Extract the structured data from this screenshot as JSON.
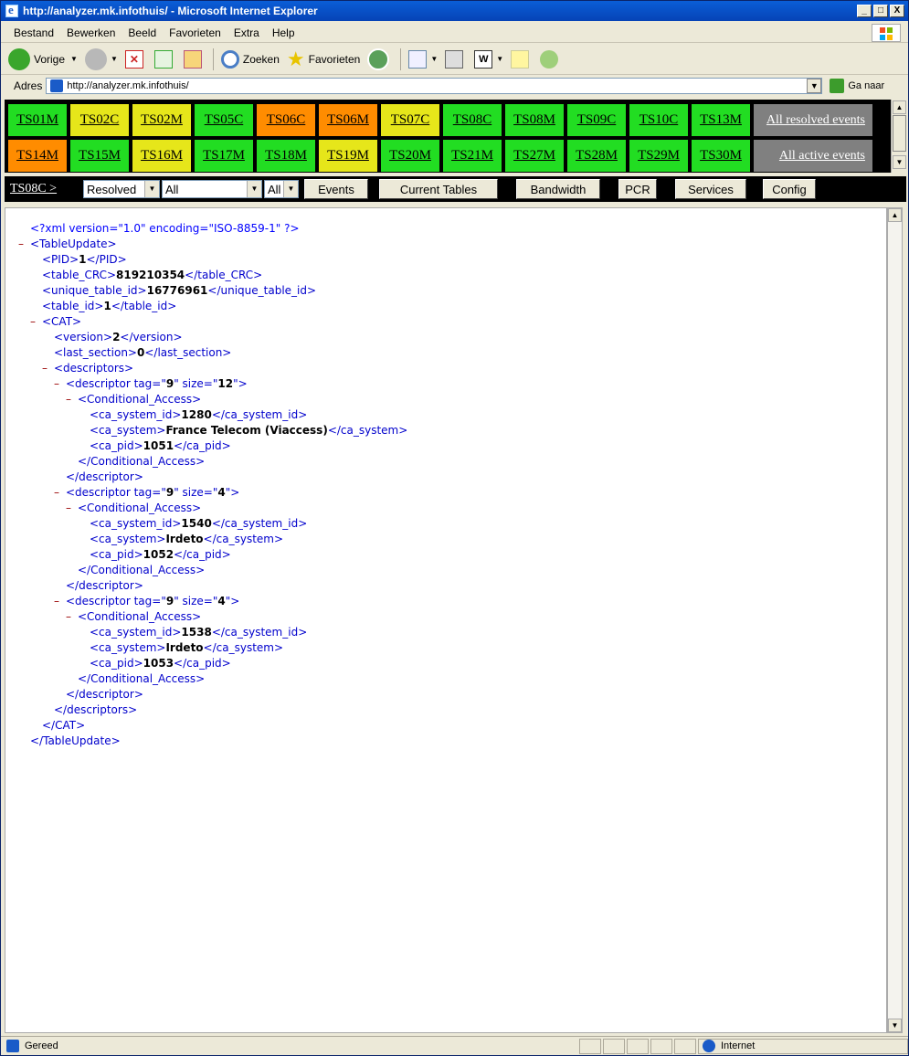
{
  "window": {
    "title": "http://analyzer.mk.infothuis/ - Microsoft Internet Explorer",
    "min": "_",
    "max": "□",
    "close": "X"
  },
  "menu": [
    "Bestand",
    "Bewerken",
    "Beeld",
    "Favorieten",
    "Extra",
    "Help"
  ],
  "toolbar": {
    "back": "Vorige",
    "search": "Zoeken",
    "favorites": "Favorieten"
  },
  "address": {
    "label": "Adres",
    "url": "http://analyzer.mk.infothuis/",
    "go": "Ga naar"
  },
  "ts_rows": [
    [
      {
        "label": "TS01M",
        "status": "green"
      },
      {
        "label": "TS02C",
        "status": "yellow"
      },
      {
        "label": "TS02M",
        "status": "yellow"
      },
      {
        "label": "TS05C",
        "status": "green"
      },
      {
        "label": "TS06C",
        "status": "orange"
      },
      {
        "label": "TS06M",
        "status": "orange"
      },
      {
        "label": "TS07C",
        "status": "yellow"
      },
      {
        "label": "TS08C",
        "status": "green"
      },
      {
        "label": "TS08M",
        "status": "green"
      },
      {
        "label": "TS09C",
        "status": "green"
      },
      {
        "label": "TS10C",
        "status": "green"
      },
      {
        "label": "TS13M",
        "status": "green"
      },
      {
        "label": "All resolved events",
        "status": "gray"
      }
    ],
    [
      {
        "label": "TS14M",
        "status": "orange"
      },
      {
        "label": "TS15M",
        "status": "green"
      },
      {
        "label": "TS16M",
        "status": "yellow"
      },
      {
        "label": "TS17M",
        "status": "green"
      },
      {
        "label": "TS18M",
        "status": "green"
      },
      {
        "label": "TS19M",
        "status": "yellow"
      },
      {
        "label": "TS20M",
        "status": "green"
      },
      {
        "label": "TS21M",
        "status": "green"
      },
      {
        "label": "TS27M",
        "status": "green"
      },
      {
        "label": "TS28M",
        "status": "green"
      },
      {
        "label": "TS29M",
        "status": "green"
      },
      {
        "label": "TS30M",
        "status": "green"
      },
      {
        "label": "All active events",
        "status": "gray"
      }
    ]
  ],
  "nav": {
    "crumb": "TS08C >",
    "select_state": "Resolved",
    "select_filter": "All",
    "select_filter2": "All",
    "buttons": [
      "Events",
      "Current Tables",
      "Bandwidth",
      "PCR",
      "Services",
      "Config"
    ]
  },
  "xml_lines": [
    {
      "indent": 0,
      "minus": "",
      "parts": [
        {
          "t": "pi",
          "v": "<?xml version=\"1.0\" encoding=\"ISO-8859-1\" ?>"
        }
      ]
    },
    {
      "indent": 0,
      "minus": "–",
      "parts": [
        {
          "t": "tg",
          "v": "<TableUpdate>"
        }
      ]
    },
    {
      "indent": 1,
      "minus": "",
      "parts": [
        {
          "t": "tg",
          "v": "<PID>"
        },
        {
          "t": "val",
          "v": "1"
        },
        {
          "t": "tg",
          "v": "</PID>"
        }
      ]
    },
    {
      "indent": 1,
      "minus": "",
      "parts": [
        {
          "t": "tg",
          "v": "<table_CRC>"
        },
        {
          "t": "val",
          "v": "819210354"
        },
        {
          "t": "tg",
          "v": "</table_CRC>"
        }
      ]
    },
    {
      "indent": 1,
      "minus": "",
      "parts": [
        {
          "t": "tg",
          "v": "<unique_table_id>"
        },
        {
          "t": "val",
          "v": "16776961"
        },
        {
          "t": "tg",
          "v": "</unique_table_id>"
        }
      ]
    },
    {
      "indent": 1,
      "minus": "",
      "parts": [
        {
          "t": "tg",
          "v": "<table_id>"
        },
        {
          "t": "val",
          "v": "1"
        },
        {
          "t": "tg",
          "v": "</table_id>"
        }
      ]
    },
    {
      "indent": 1,
      "minus": "–",
      "parts": [
        {
          "t": "tg",
          "v": "<CAT>"
        }
      ]
    },
    {
      "indent": 2,
      "minus": "",
      "parts": [
        {
          "t": "tg",
          "v": "<version>"
        },
        {
          "t": "val",
          "v": "2"
        },
        {
          "t": "tg",
          "v": "</version>"
        }
      ]
    },
    {
      "indent": 2,
      "minus": "",
      "parts": [
        {
          "t": "tg",
          "v": "<last_section>"
        },
        {
          "t": "val",
          "v": "0"
        },
        {
          "t": "tg",
          "v": "</last_section>"
        }
      ]
    },
    {
      "indent": 2,
      "minus": "–",
      "parts": [
        {
          "t": "tg",
          "v": "<descriptors>"
        }
      ]
    },
    {
      "indent": 3,
      "minus": "–",
      "parts": [
        {
          "t": "tg",
          "v": "<descriptor tag=\""
        },
        {
          "t": "val",
          "v": "9"
        },
        {
          "t": "tg",
          "v": "\" size=\""
        },
        {
          "t": "val",
          "v": "12"
        },
        {
          "t": "tg",
          "v": "\">"
        }
      ]
    },
    {
      "indent": 4,
      "minus": "–",
      "parts": [
        {
          "t": "tg",
          "v": "<Conditional_Access>"
        }
      ]
    },
    {
      "indent": 5,
      "minus": "",
      "parts": [
        {
          "t": "tg",
          "v": "<ca_system_id>"
        },
        {
          "t": "val",
          "v": "1280"
        },
        {
          "t": "tg",
          "v": "</ca_system_id>"
        }
      ]
    },
    {
      "indent": 5,
      "minus": "",
      "parts": [
        {
          "t": "tg",
          "v": "<ca_system>"
        },
        {
          "t": "val",
          "v": "France Telecom (Viaccess)"
        },
        {
          "t": "tg",
          "v": "</ca_system>"
        }
      ]
    },
    {
      "indent": 5,
      "minus": "",
      "parts": [
        {
          "t": "tg",
          "v": "<ca_pid>"
        },
        {
          "t": "val",
          "v": "1051"
        },
        {
          "t": "tg",
          "v": "</ca_pid>"
        }
      ]
    },
    {
      "indent": 4,
      "minus": "",
      "parts": [
        {
          "t": "tg",
          "v": "</Conditional_Access>"
        }
      ]
    },
    {
      "indent": 3,
      "minus": "",
      "parts": [
        {
          "t": "tg",
          "v": "</descriptor>"
        }
      ]
    },
    {
      "indent": 3,
      "minus": "–",
      "parts": [
        {
          "t": "tg",
          "v": "<descriptor tag=\""
        },
        {
          "t": "val",
          "v": "9"
        },
        {
          "t": "tg",
          "v": "\" size=\""
        },
        {
          "t": "val",
          "v": "4"
        },
        {
          "t": "tg",
          "v": "\">"
        }
      ]
    },
    {
      "indent": 4,
      "minus": "–",
      "parts": [
        {
          "t": "tg",
          "v": "<Conditional_Access>"
        }
      ]
    },
    {
      "indent": 5,
      "minus": "",
      "parts": [
        {
          "t": "tg",
          "v": "<ca_system_id>"
        },
        {
          "t": "val",
          "v": "1540"
        },
        {
          "t": "tg",
          "v": "</ca_system_id>"
        }
      ]
    },
    {
      "indent": 5,
      "minus": "",
      "parts": [
        {
          "t": "tg",
          "v": "<ca_system>"
        },
        {
          "t": "val",
          "v": "Irdeto"
        },
        {
          "t": "tg",
          "v": "</ca_system>"
        }
      ]
    },
    {
      "indent": 5,
      "minus": "",
      "parts": [
        {
          "t": "tg",
          "v": "<ca_pid>"
        },
        {
          "t": "val",
          "v": "1052"
        },
        {
          "t": "tg",
          "v": "</ca_pid>"
        }
      ]
    },
    {
      "indent": 4,
      "minus": "",
      "parts": [
        {
          "t": "tg",
          "v": "</Conditional_Access>"
        }
      ]
    },
    {
      "indent": 3,
      "minus": "",
      "parts": [
        {
          "t": "tg",
          "v": "</descriptor>"
        }
      ]
    },
    {
      "indent": 3,
      "minus": "–",
      "parts": [
        {
          "t": "tg",
          "v": "<descriptor tag=\""
        },
        {
          "t": "val",
          "v": "9"
        },
        {
          "t": "tg",
          "v": "\" size=\""
        },
        {
          "t": "val",
          "v": "4"
        },
        {
          "t": "tg",
          "v": "\">"
        }
      ]
    },
    {
      "indent": 4,
      "minus": "–",
      "parts": [
        {
          "t": "tg",
          "v": "<Conditional_Access>"
        }
      ]
    },
    {
      "indent": 5,
      "minus": "",
      "parts": [
        {
          "t": "tg",
          "v": "<ca_system_id>"
        },
        {
          "t": "val",
          "v": "1538"
        },
        {
          "t": "tg",
          "v": "</ca_system_id>"
        }
      ]
    },
    {
      "indent": 5,
      "minus": "",
      "parts": [
        {
          "t": "tg",
          "v": "<ca_system>"
        },
        {
          "t": "val",
          "v": "Irdeto"
        },
        {
          "t": "tg",
          "v": "</ca_system>"
        }
      ]
    },
    {
      "indent": 5,
      "minus": "",
      "parts": [
        {
          "t": "tg",
          "v": "<ca_pid>"
        },
        {
          "t": "val",
          "v": "1053"
        },
        {
          "t": "tg",
          "v": "</ca_pid>"
        }
      ]
    },
    {
      "indent": 4,
      "minus": "",
      "parts": [
        {
          "t": "tg",
          "v": "</Conditional_Access>"
        }
      ]
    },
    {
      "indent": 3,
      "minus": "",
      "parts": [
        {
          "t": "tg",
          "v": "</descriptor>"
        }
      ]
    },
    {
      "indent": 2,
      "minus": "",
      "parts": [
        {
          "t": "tg",
          "v": "</descriptors>"
        }
      ]
    },
    {
      "indent": 1,
      "minus": "",
      "parts": [
        {
          "t": "tg",
          "v": "</CAT>"
        }
      ]
    },
    {
      "indent": 0,
      "minus": "",
      "parts": [
        {
          "t": "tg",
          "v": "</TableUpdate>"
        }
      ]
    }
  ],
  "status": {
    "text": "Gereed",
    "zone": "Internet"
  }
}
